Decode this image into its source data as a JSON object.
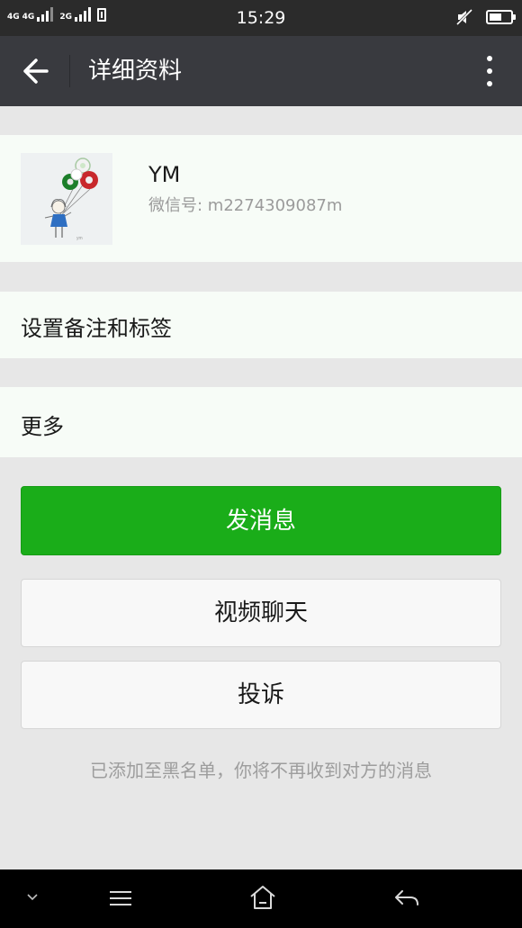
{
  "status_bar": {
    "network_1": "4G",
    "network_2": "4G",
    "network_3": "2G",
    "time": "15:29"
  },
  "header": {
    "title": "详细资料"
  },
  "profile": {
    "nickname": "YM",
    "wechat_id_label": "微信号: ",
    "wechat_id": "m2274309087m"
  },
  "rows": {
    "set_remark_label": "设置备注和标签",
    "more_label": "更多"
  },
  "buttons": {
    "send_message": "发消息",
    "video_chat": "视频聊天",
    "report": "投诉"
  },
  "notice": "已添加至黑名单，你将不再收到对方的消息",
  "colors": {
    "primary_green": "#1aad19",
    "title_bar": "#393a3f",
    "status_bar": "#2b2b2b",
    "page_bg": "#e7e7e7"
  },
  "icons": {
    "back": "arrow-left-icon",
    "more": "vertical-ellipsis-icon",
    "nav_down": "chevron-down-icon",
    "nav_menu": "hamburger-menu-icon",
    "nav_home": "home-icon",
    "nav_back": "return-arrow-icon"
  }
}
